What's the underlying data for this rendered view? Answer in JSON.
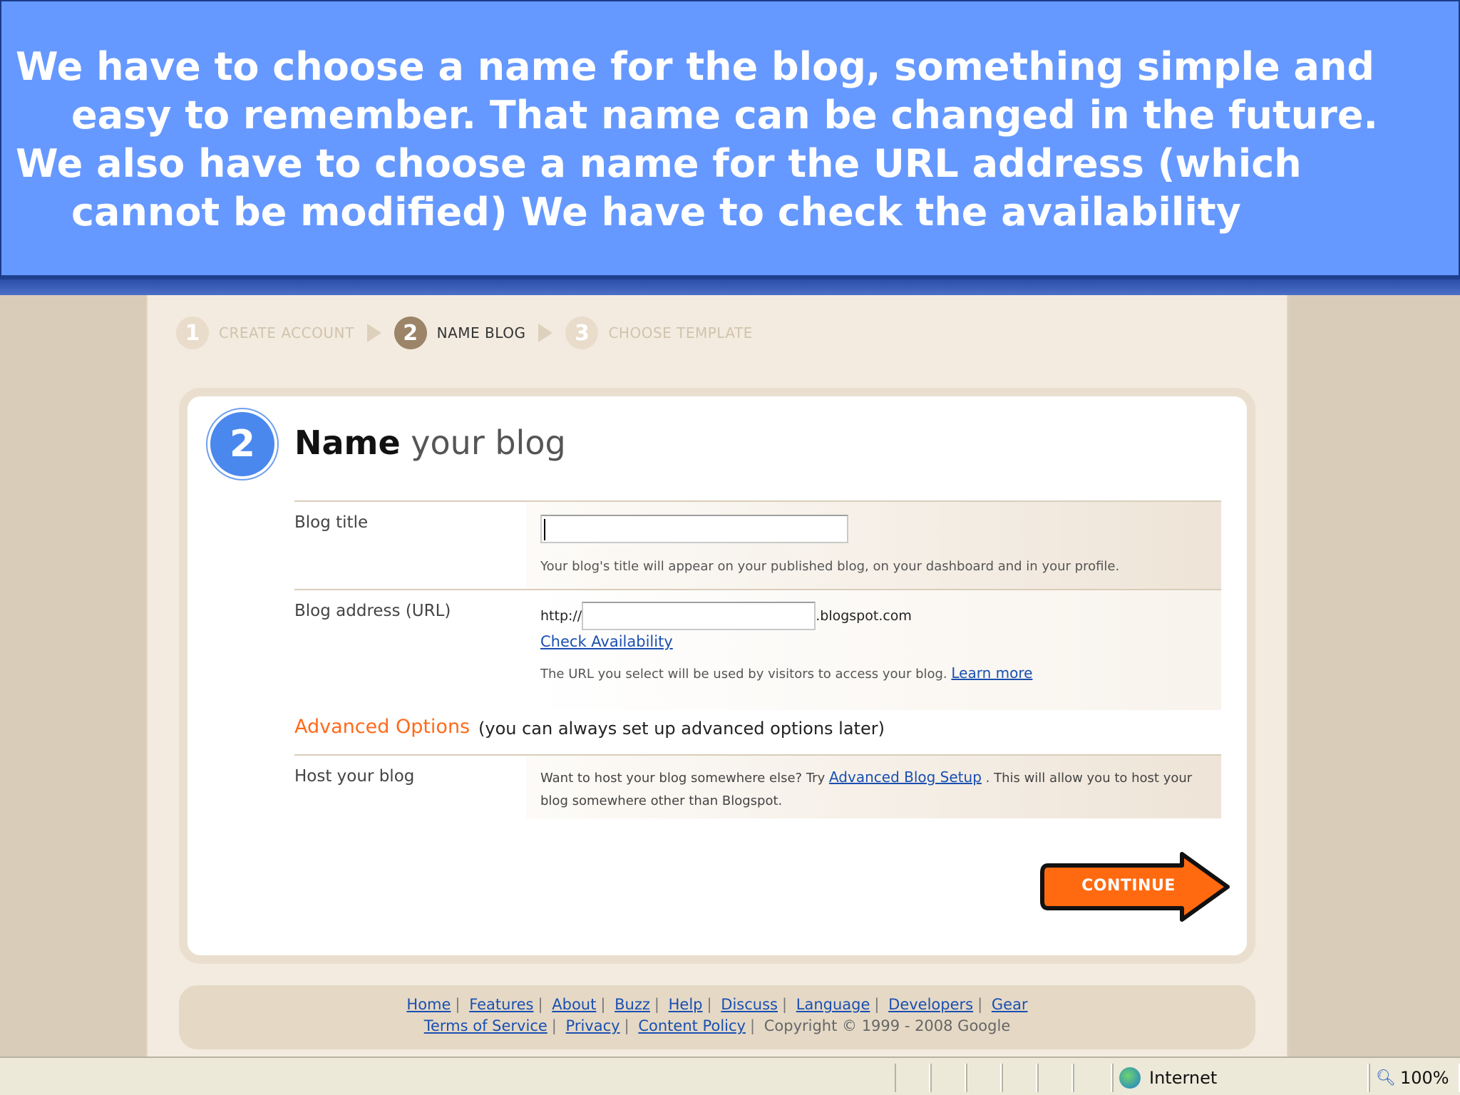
{
  "banner": {
    "line1": "We have to choose a name for the blog, something simple and easy to remember. That name can be changed in the future.",
    "line2": "We also have to choose a name for the URL address (which cannot be modified) We have to check the availability"
  },
  "steps": [
    {
      "number": "1",
      "label": "CREATE ACCOUNT",
      "active": false
    },
    {
      "number": "2",
      "label": "NAME BLOG",
      "active": true
    },
    {
      "number": "3",
      "label": "CHOOSE TEMPLATE",
      "active": false
    }
  ],
  "panel": {
    "step_number": "2",
    "title_bold": "Name",
    "title_rest": " your blog",
    "blog_title": {
      "label": "Blog title",
      "value": "",
      "hint": "Your blog's title will appear on your published blog, on your dashboard and in your profile."
    },
    "blog_address": {
      "label": "Blog address (URL)",
      "prefix": "http://",
      "value": "",
      "suffix": ".blogspot.com",
      "check_link": "Check Availability",
      "hint": "The URL you select will be used by visitors to access your blog.",
      "learn_more": "Learn more"
    },
    "advanced_options": "Advanced Options",
    "advanced_note": "(you can always set up advanced options later)",
    "host": {
      "label": "Host your blog",
      "text_before": "Want to host your blog somewhere else? Try",
      "link": "Advanced Blog Setup",
      "text_after": ". This will allow you to host your blog somewhere other than Blogspot."
    },
    "continue_label": "CONTINUE"
  },
  "footer": {
    "links_row1": [
      "Home",
      "Features",
      "About",
      "Buzz",
      "Help",
      "Discuss",
      "Language",
      "Developers",
      "Gear"
    ],
    "links_row2": [
      "Terms of Service",
      "Privacy",
      "Content Policy"
    ],
    "copyright": "Copyright © 1999 - 2008 Google"
  },
  "statusbar": {
    "zone": "Internet",
    "zoom": "100%"
  },
  "colors": {
    "banner_bg": "#6699ff",
    "accent_orange": "#ff6a1a",
    "step_circle_blue": "#4a88ee",
    "link_blue": "#1a4fb0"
  },
  "icons": [
    "internet-globe-icon",
    "zoom-icon",
    "continue-arrow-icon"
  ]
}
